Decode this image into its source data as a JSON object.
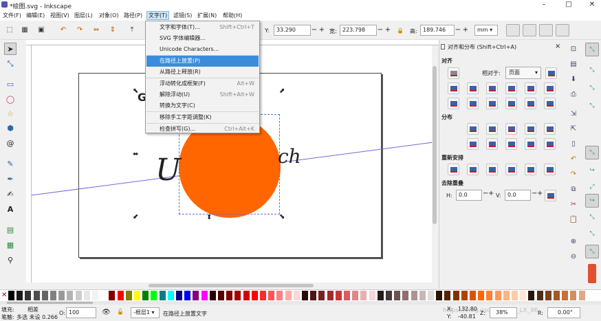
{
  "window": {
    "title": "*绘图.svg - Inkscape",
    "min": "–",
    "max": "□",
    "close": "✕"
  },
  "menubar": [
    "文件(F)",
    "编辑(E)",
    "视图(V)",
    "图层(L)",
    "对象(O)",
    "路径(P)",
    "文字(T)",
    "滤镜(S)",
    "扩展(N)",
    "帮助(H)"
  ],
  "toolbar": {
    "y_label": "Y:",
    "y_value": "33.290",
    "w_label": "宽:",
    "w_value": "223.798",
    "h_label": "高:",
    "h_value": "189.746",
    "unit": "mm",
    "minus": "−",
    "plus": "+"
  },
  "text_menu": [
    {
      "label": "文字和字体(T)...",
      "key": "Shift+Ctrl+T"
    },
    {
      "label": "SVG 字体编辑器...",
      "key": ""
    },
    {
      "label": "Unicode Characters...",
      "key": ""
    },
    {
      "label": "在路径上放置(P)",
      "key": "",
      "selected": true
    },
    {
      "label": "从路径上释放(R)",
      "key": ""
    },
    {
      "label": "浮动转化成框架(F)",
      "key": "Alt+W"
    },
    {
      "label": "解除浮动(U)",
      "key": "Shift+Alt+W"
    },
    {
      "label": "转换为文字(C)",
      "key": ""
    },
    {
      "label": "移除手工字距调整(K)",
      "key": ""
    },
    {
      "label": "检查拼写(G)...",
      "key": "Ctrl+Alt+K"
    }
  ],
  "canvas": {
    "text_left": "U",
    "text_right": "ch",
    "text_top": "G",
    "circle_color": "#ff6600",
    "guide_color": "#6b6bd8"
  },
  "panel": {
    "title": "对齐和分布 (Shift+Ctrl+A)",
    "close": "×",
    "align_header": "对齐",
    "relative_label": "相对于:",
    "relative_value": "页面",
    "distribute_header": "分布",
    "rearrange_header": "重新安排",
    "overlap_header": "去除重叠",
    "h_label": "H:",
    "h_value": "0.0",
    "v_label": "V:",
    "v_value": "0.0"
  },
  "status": {
    "fill_label": "填充:",
    "fill_value": "相差",
    "stroke_label": "笔触:",
    "stroke_value": "多选 未设 0.266",
    "opacity_label": "O:",
    "opacity_value": "100",
    "layer_value": "-根层1",
    "message": "在路径上放置文字",
    "x_label": "X:",
    "x_value": "132.80",
    "y_label": "Y:",
    "y_value": "-40.81",
    "z_label": "Z:",
    "zoom_value": "38%",
    "r_label": "R:",
    "rotate_value": "0.00°",
    "watermark": "https://blog.csdn.net/liu_LX_96"
  },
  "palette": [
    "#000000",
    "#1a1a1a",
    "#333333",
    "#4d4d4d",
    "#666666",
    "#808080",
    "#999999",
    "#b3b3b3",
    "#cccccc",
    "#e6e6e6",
    "#f2f2f2",
    "#ffffff",
    "#800000",
    "#ff0000",
    "#808000",
    "#ffff00",
    "#008000",
    "#00ff00",
    "#008080",
    "#00ffff",
    "#000080",
    "#0000ff",
    "#800080",
    "#ff00ff",
    "#2b0000",
    "#550000",
    "#800000",
    "#aa0000",
    "#d40000",
    "#ff0000",
    "#ff2a2a",
    "#ff5555",
    "#ff8080",
    "#ffaaaa",
    "#ffd5d5",
    "#280b0b",
    "#501616",
    "#782121",
    "#a02c2c",
    "#c83737",
    "#d35f5f",
    "#de8787",
    "#e9afaf",
    "#f4d7d7",
    "#241c1c",
    "#483737",
    "#6c5353",
    "#916f6f",
    "#ac9393",
    "#c8b7b7",
    "#e3dbdb",
    "#2b1100",
    "#552200",
    "#803300",
    "#aa4400",
    "#d45500",
    "#ff6600",
    "#ff7f2a",
    "#ff9955",
    "#ffb380",
    "#ffccaa",
    "#ffe6d5",
    "#28170b",
    "#502d16",
    "#784421",
    "#a05a2c",
    "#c87137",
    "#d38d5f",
    "#deaa87"
  ]
}
